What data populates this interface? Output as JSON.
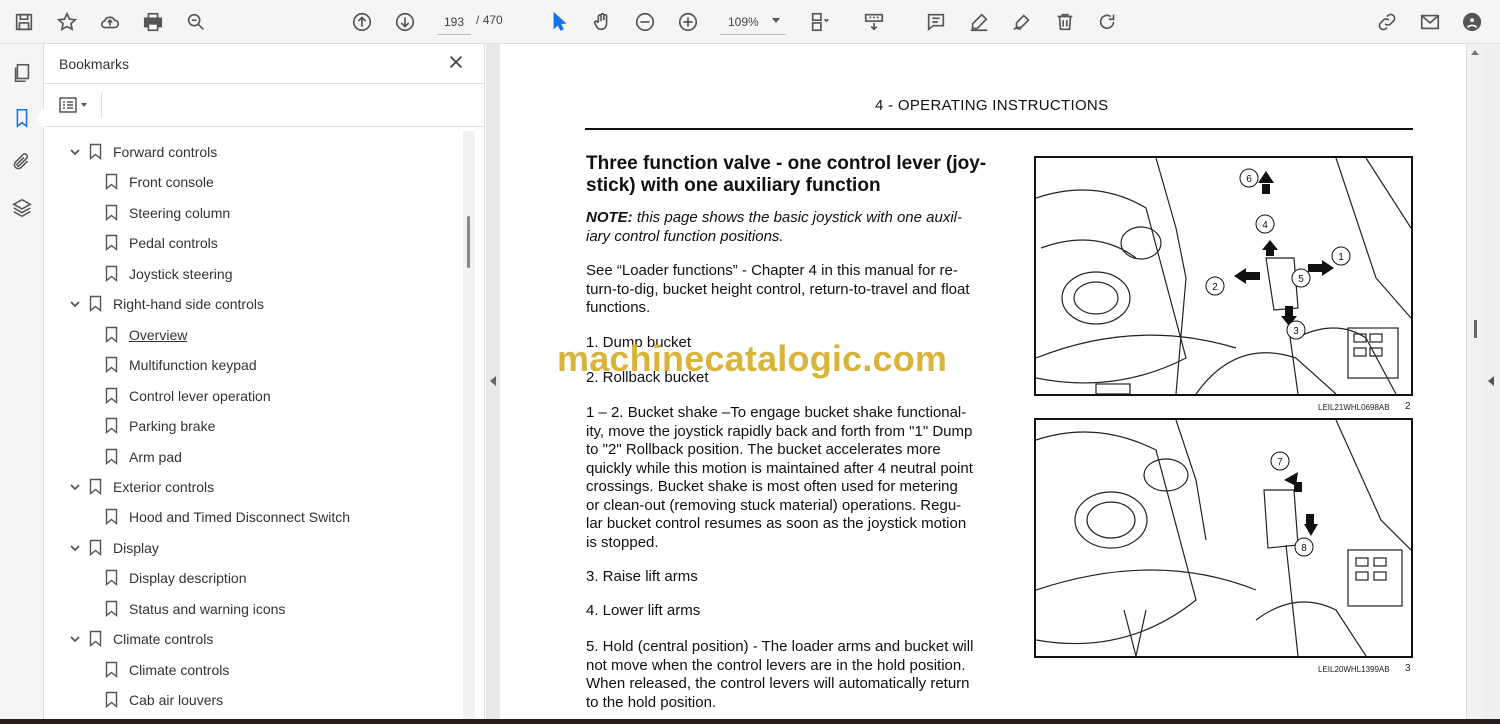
{
  "toolbar": {
    "current_page": "193",
    "page_separator": "/",
    "total_pages": "470",
    "zoom": "109%"
  },
  "bookmarks_panel": {
    "title": "Bookmarks",
    "items": [
      {
        "label": "Forward controls",
        "level": 1,
        "expanded": true
      },
      {
        "label": "Front console",
        "level": 2
      },
      {
        "label": "Steering column",
        "level": 2
      },
      {
        "label": "Pedal controls",
        "level": 2
      },
      {
        "label": "Joystick steering",
        "level": 2
      },
      {
        "label": "Right-hand side controls",
        "level": 1,
        "expanded": true
      },
      {
        "label": "Overview",
        "level": 2,
        "current": true
      },
      {
        "label": "Multifunction keypad",
        "level": 2
      },
      {
        "label": "Control lever operation",
        "level": 2
      },
      {
        "label": "Parking brake",
        "level": 2
      },
      {
        "label": "Arm pad",
        "level": 2
      },
      {
        "label": "Exterior controls",
        "level": 1,
        "expanded": true
      },
      {
        "label": "Hood and Timed Disconnect Switch",
        "level": 2
      },
      {
        "label": "Display",
        "level": 1,
        "expanded": true
      },
      {
        "label": "Display description",
        "level": 2
      },
      {
        "label": "Status and warning icons",
        "level": 2
      },
      {
        "label": "Climate controls",
        "level": 1,
        "expanded": true
      },
      {
        "label": "Climate controls",
        "level": 2
      },
      {
        "label": "Cab air louvers",
        "level": 2
      }
    ]
  },
  "document": {
    "header": "4 - OPERATING INSTRUCTIONS",
    "section_title_line1": "Three function valve - one control lever (joy-",
    "section_title_line2": "stick) with one auxiliary function",
    "note_label": "NOTE:",
    "note_text": " this page shows the basic joystick with one auxil-",
    "note_text2": "iary control function positions.",
    "see_text": [
      "See “Loader functions” - Chapter 4 in this manual for re-",
      "turn-to-dig, bucket height control, return-to-travel and float",
      "functions."
    ],
    "item1": "1.  Dump bucket",
    "item2": "2.  Rollback bucket",
    "shake_text": [
      "1 – 2. Bucket shake –To engage bucket shake functional-",
      "ity, move the joystick rapidly back and forth from \"1\" Dump",
      "to \"2\" Rollback position.  The bucket accelerates more",
      "quickly while this motion is maintained after 4 neutral point",
      "crossings. Bucket shake is most often used for metering",
      "or clean-out (removing stuck material) operations. Regu-",
      "lar bucket control resumes as soon as the joystick motion",
      "is stopped."
    ],
    "item3": "3.  Raise lift arms",
    "item4": "4.  Lower lift arms",
    "item5": [
      "5. Hold (central position) - The loader arms and bucket will",
      "not move when the control levers are in the hold position.",
      "When released, the control levers will automatically return",
      "to the hold position."
    ],
    "watermark": "machinecatalogic.com",
    "figure1": {
      "caption": "LEIL21WHL0698AB",
      "number": "2",
      "labels": [
        "1",
        "2",
        "3",
        "4",
        "5",
        "6"
      ]
    },
    "figure2": {
      "caption": "LEIL20WHL1399AB",
      "number": "3",
      "labels": [
        "7",
        "8"
      ]
    }
  }
}
